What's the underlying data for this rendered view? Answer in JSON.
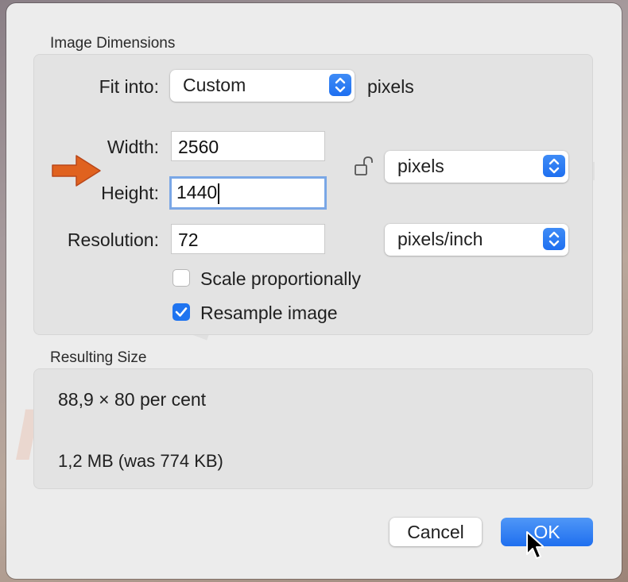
{
  "dimensions": {
    "title": "Image Dimensions",
    "fit_into": {
      "label": "Fit into:",
      "value": "Custom",
      "suffix": "pixels"
    },
    "width": {
      "label": "Width:",
      "value": "2560"
    },
    "height": {
      "label": "Height:",
      "value": "1440"
    },
    "resolution": {
      "label": "Resolution:",
      "value": "72"
    },
    "size_unit": {
      "value": "pixels"
    },
    "resolution_unit": {
      "value": "pixels/inch"
    },
    "scale_proportionally": {
      "label": "Scale proportionally",
      "checked": false
    },
    "resample_image": {
      "label": "Resample image",
      "checked": true
    }
  },
  "resulting": {
    "title": "Resulting Size",
    "percent": "88,9 × 80 per cent",
    "file_size": "1,2 MB (was 774 KB)"
  },
  "buttons": {
    "cancel": "Cancel",
    "ok": "OK"
  },
  "watermark": {
    "text": "risk.com",
    "brand": "PC"
  },
  "colors": {
    "accent": "#1f74f0",
    "arrow": "#e0621f"
  }
}
